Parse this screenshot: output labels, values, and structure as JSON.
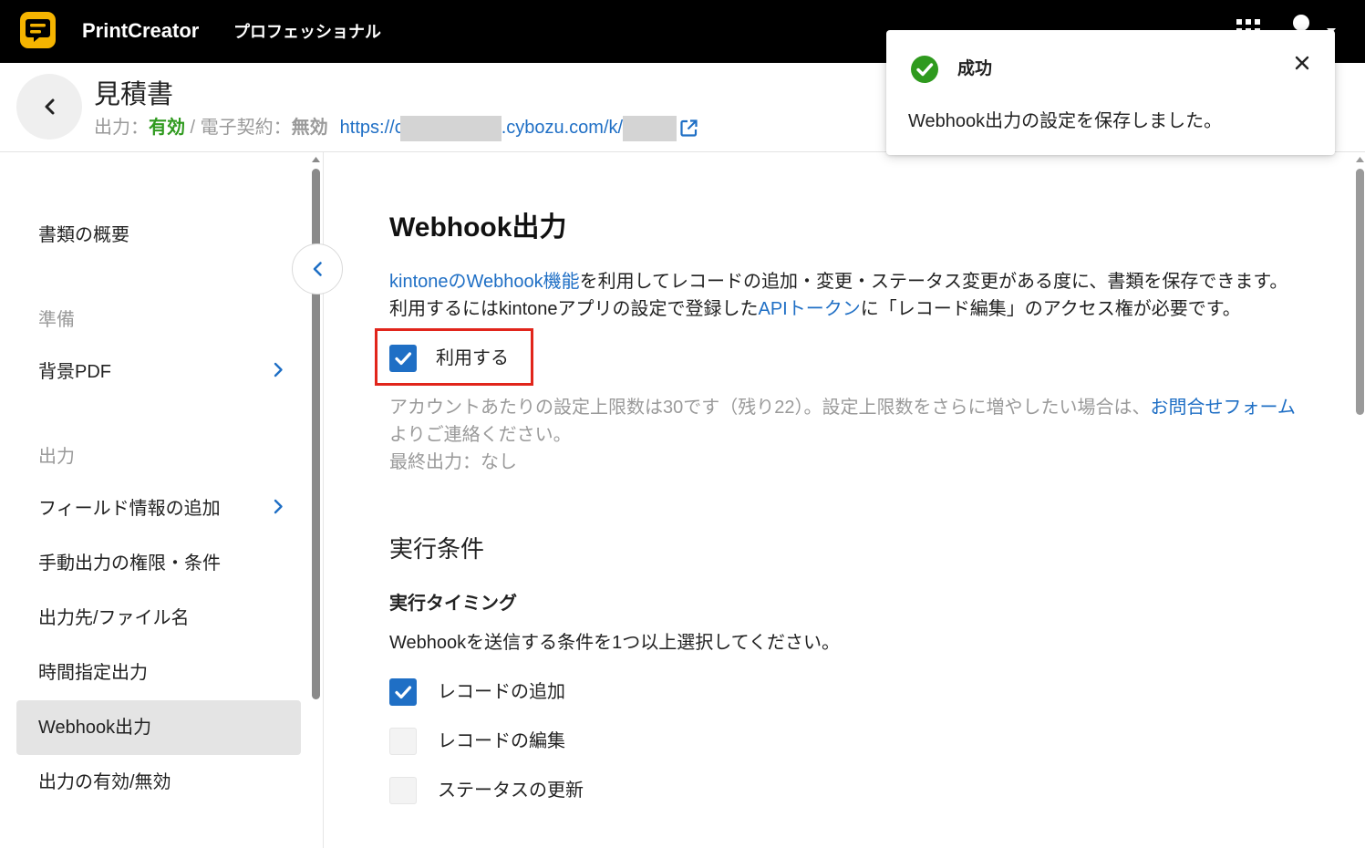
{
  "header": {
    "app_name": "PrintCreator",
    "plan": "プロフェッショナル"
  },
  "icons": {
    "logo": "printcreator-logo-icon",
    "apps": "apps-grid-icon",
    "account": "user-account-icon",
    "account_caret": "caret-down-icon",
    "back": "chevron-left-icon",
    "external_link": "external-link-icon",
    "toast_status": "check-circle-icon",
    "toast_close": "close-icon",
    "sidebar_collapse": "chevron-left-icon",
    "nav_expand": "chevron-right-icon",
    "checkbox_check": "check-icon"
  },
  "colors": {
    "accent": "#1f6fc5",
    "success": "#2f9a1e",
    "highlight": "#e1251b",
    "muted": "#9a9a9a",
    "topbar": "#000000",
    "logo": "#f5b400",
    "selected": "#e4e4e4"
  },
  "toast": {
    "title": "成功",
    "message": "Webhook出力の設定を保存しました。"
  },
  "page": {
    "title": "見積書",
    "output_label": "出力：",
    "output_value": "有効",
    "separator": " / ",
    "contract_label": "電子契約：",
    "contract_value": "無効",
    "url_start": "https://c",
    "url_middle": ".cybozu.com/k/"
  },
  "sidebar": {
    "items": [
      {
        "label": "書類の概要"
      },
      {
        "label": "準備",
        "section_header": true
      },
      {
        "label": "背景PDF",
        "has_submenu": true
      },
      {
        "label": "出力",
        "section_header": true
      },
      {
        "label": "フィールド情報の追加",
        "has_submenu": true
      },
      {
        "label": "手動出力の権限・条件"
      },
      {
        "label": "出力先/ファイル名"
      },
      {
        "label": "時間指定出力"
      },
      {
        "label": "Webhook出力",
        "selected": true
      },
      {
        "label": "出力の有効/無効"
      }
    ]
  },
  "main": {
    "title": "Webhook出力",
    "description": {
      "link1": "kintoneのWebhook機能",
      "text1": "を利用してレコードの追加・変更・ステータス変更がある度に、書類を保存できます。",
      "text2": "利用するにはkintoneアプリの設定で登録した",
      "link2": "APIトークン",
      "text3": "に「レコード編集」のアクセス権が必要です。"
    },
    "enable": {
      "label": "利用する",
      "checked": true
    },
    "limit_note": {
      "text1": "アカウントあたりの設定上限数は30です（残り22）。設定上限数をさらに増やしたい場合は、",
      "link": "お問合せフォーム",
      "text2": "よりご連絡ください。"
    },
    "last_output": "最終出力：なし",
    "conditions": {
      "title": "実行条件",
      "timing_title": "実行タイミング",
      "timing_help": "Webhookを送信する条件を1つ以上選択してください。",
      "options": [
        {
          "label": "レコードの追加",
          "checked": true
        },
        {
          "label": "レコードの編集",
          "checked": false
        },
        {
          "label": "ステータスの更新",
          "checked": false
        }
      ]
    }
  }
}
